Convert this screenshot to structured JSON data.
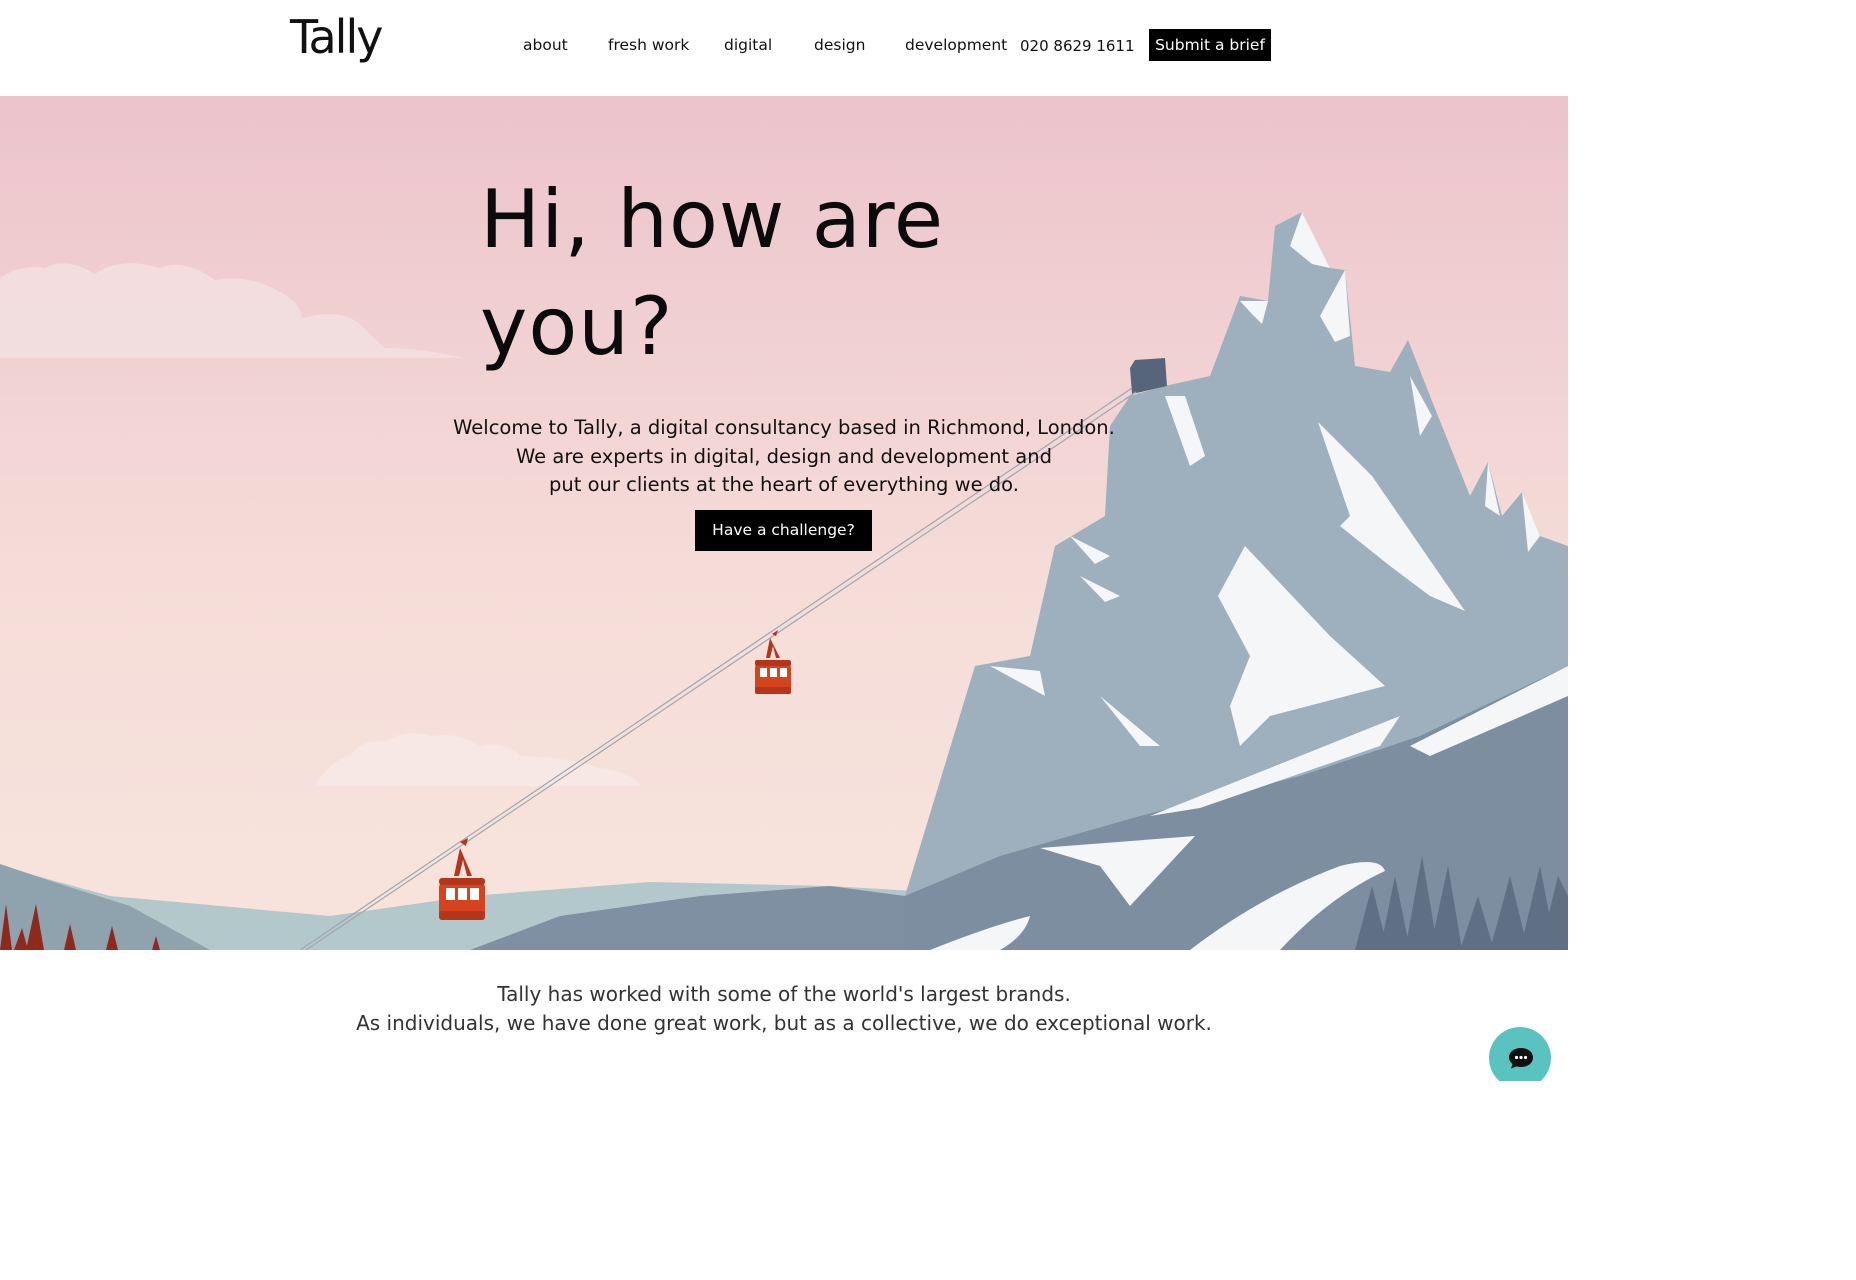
{
  "header": {
    "logo_text": "Tally",
    "nav": {
      "about": "about",
      "fresh_work": "fresh work",
      "digital": "digital",
      "design": "design",
      "development": "development"
    },
    "phone": "020 8629 1611",
    "brief_button": "Submit a brief"
  },
  "hero": {
    "title_line1": "Hi, how are",
    "title_line2": "you?",
    "intro_line1": "Welcome to Tally, a digital consultancy based in Richmond, London.",
    "intro_line2": "We are experts in digital, design and development and",
    "intro_line3": "put our clients at the heart of everything we do.",
    "cta_button": "Have a challenge?"
  },
  "brands": {
    "line1": "Tally has worked with some of the world's largest brands.",
    "line2": "As individuals, we have done great work, but as a collective, we do exceptional work."
  },
  "chat": {
    "icon": "chat-bubble-icon"
  },
  "colors": {
    "sky_top": "#ecc4cc",
    "sky_bottom": "#f8e3dc",
    "mountain": "#9eafbd",
    "mountain_dark": "#7d8ea0",
    "snow": "#f4f6f8",
    "gondola": "#d8431f",
    "chat": "#5ac3bf"
  }
}
